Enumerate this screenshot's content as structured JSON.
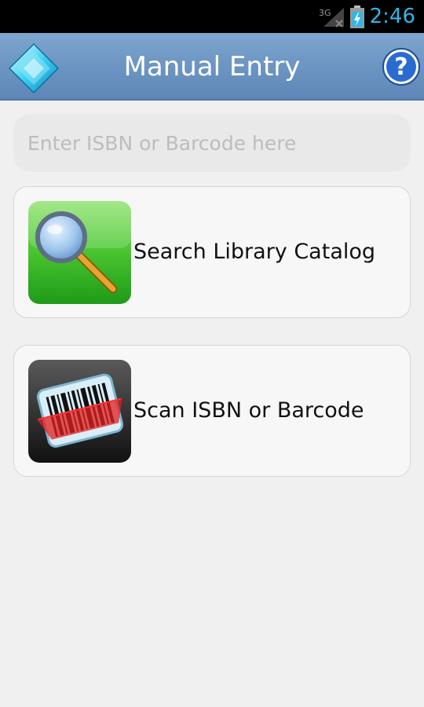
{
  "status_bar": {
    "network": "3G",
    "time": "2:46",
    "icons": [
      "signal-icon",
      "battery-charging-icon"
    ]
  },
  "header": {
    "title": "Manual Entry",
    "logo_icon": "diamond-logo-icon",
    "help_icon": "help-icon",
    "help_label": "?"
  },
  "search": {
    "placeholder": "Enter ISBN or Barcode here",
    "value": ""
  },
  "actions": [
    {
      "label": "Search Library Catalog",
      "icon": "magnifier-icon"
    },
    {
      "label": "Scan ISBN or Barcode",
      "icon": "barcode-scanner-icon"
    }
  ],
  "colors": {
    "header": "#6f98c5",
    "clock": "#33b5e5",
    "background": "#f0f0f0",
    "search_icon_bg": "#3cb82a",
    "scan_icon_bg": "#2a2a2a"
  }
}
